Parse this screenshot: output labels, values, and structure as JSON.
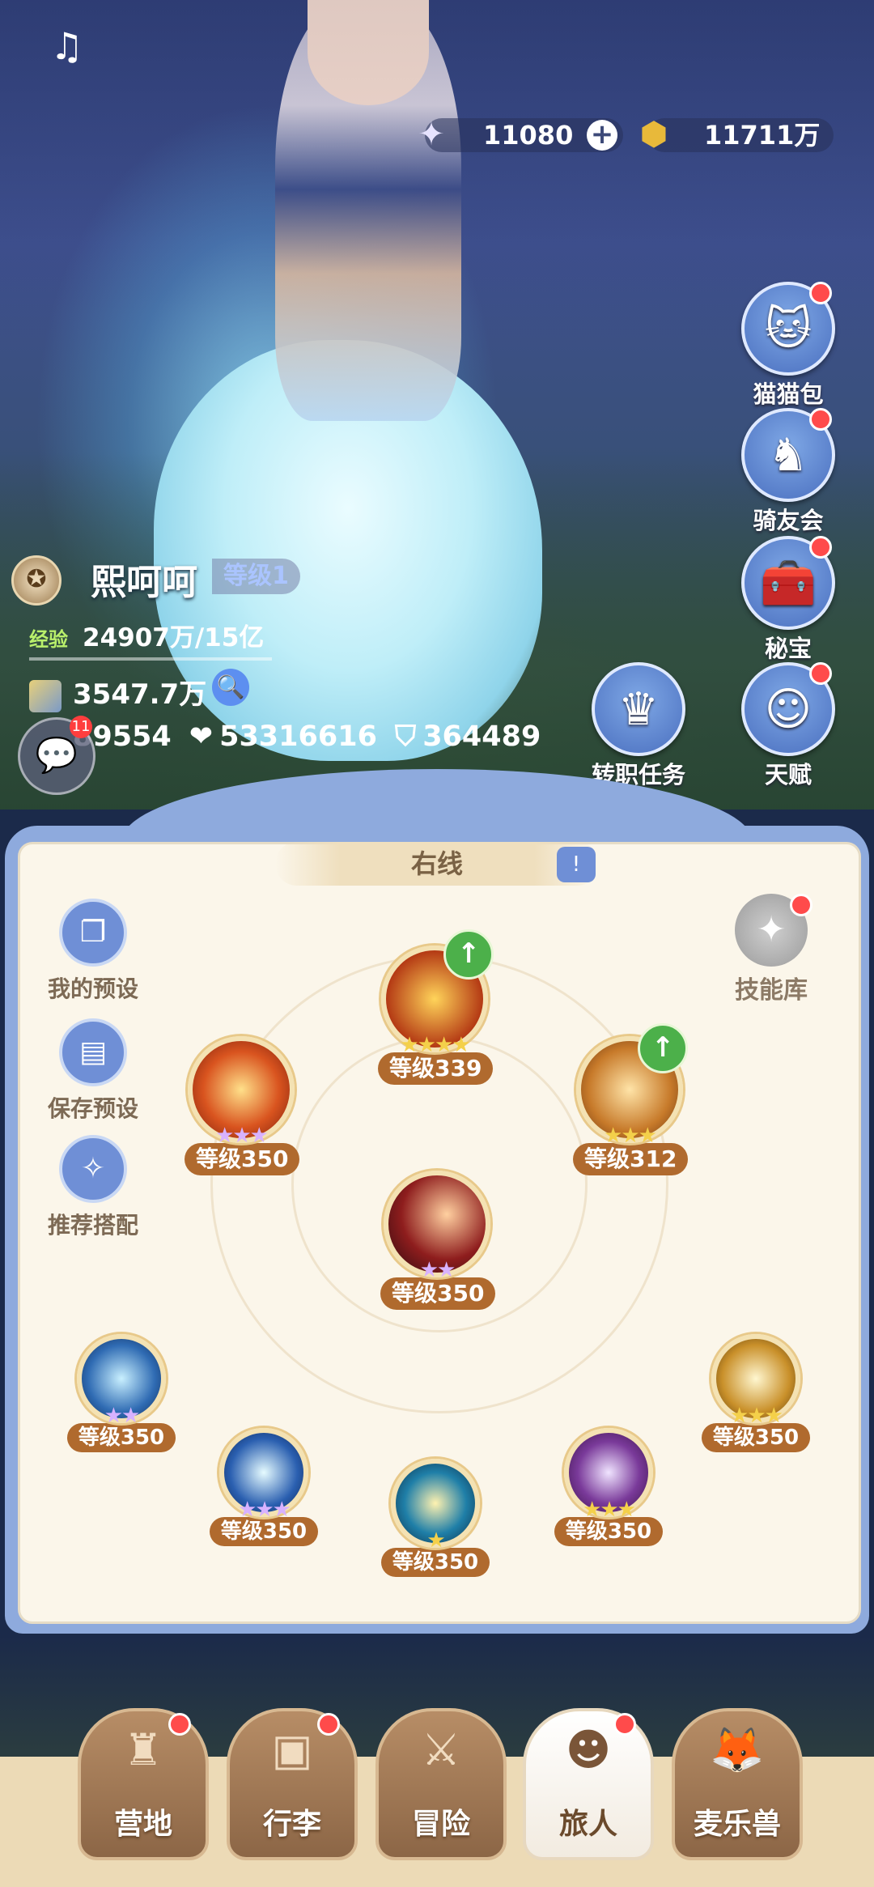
{
  "currency": {
    "stars": "11080",
    "gold": "11711万"
  },
  "side_menu": [
    {
      "label": "猫猫包",
      "icon": "cat-bag-icon"
    },
    {
      "label": "骑友会",
      "icon": "horse-icon"
    },
    {
      "label": "秘宝",
      "icon": "treasure-chest-icon"
    },
    {
      "label": "天赋",
      "icon": "talent-head-icon"
    },
    {
      "label": "转职任务",
      "icon": "crown-badge-icon"
    }
  ],
  "player": {
    "name": "熙呵呵",
    "level_tag": "等级1",
    "exp_label": "经验",
    "exp_value": "24907万/15亿",
    "power": "3547.7万",
    "attack_partial": "89554",
    "hp": "53316616",
    "defense": "364489",
    "chat_badge": "11"
  },
  "skill_panel": {
    "line_title": "右线",
    "actions": [
      "我的预设",
      "保存预设",
      "推荐搭配"
    ],
    "skill_library": "技能库",
    "skills": [
      {
        "id": "top",
        "level": "等级339",
        "stars": "★★★★",
        "star_color": "#f4d04a",
        "orb": "#b43a14",
        "upgrade": true
      },
      {
        "id": "left",
        "level": "等级350",
        "stars": "★★★",
        "star_color": "#d8b2ff",
        "orb": "#d9541f",
        "upgrade": false
      },
      {
        "id": "right",
        "level": "等级312",
        "stars": "★★★",
        "star_color": "#f4d04a",
        "orb": "#c77a2a",
        "upgrade": true
      },
      {
        "id": "center",
        "level": "等级350",
        "stars": "★★",
        "star_color": "#d8b2ff",
        "orb": "#8e1d1d",
        "upgrade": false
      },
      {
        "id": "p1",
        "level": "等级350",
        "stars": "★★",
        "star_color": "#d8b2ff",
        "orb": "#2f6bb3",
        "upgrade": false
      },
      {
        "id": "p2",
        "level": "等级350",
        "stars": "★★★",
        "star_color": "#d8b2ff",
        "orb": "#2a5fb0",
        "upgrade": false
      },
      {
        "id": "p3",
        "level": "等级350",
        "stars": "★",
        "star_color": "#f4d04a",
        "orb": "#1f7fa8",
        "upgrade": false
      },
      {
        "id": "p4",
        "level": "等级350",
        "stars": "★★★",
        "star_color": "#f4d04a",
        "orb": "#7a3a9a",
        "upgrade": false
      },
      {
        "id": "p5",
        "level": "等级350",
        "stars": "★★★",
        "star_color": "#f4d04a",
        "orb": "#c9902a",
        "upgrade": false
      }
    ]
  },
  "bottom_nav": [
    {
      "label": "营地",
      "icon": "castle-icon",
      "active": false
    },
    {
      "label": "行李",
      "icon": "backpack-icon",
      "active": false
    },
    {
      "label": "冒险",
      "icon": "crossed-swords-icon",
      "active": false
    },
    {
      "label": "旅人",
      "icon": "traveler-avatar-icon",
      "active": true
    },
    {
      "label": "麦乐兽",
      "icon": "fox-pet-icon",
      "active": false
    }
  ]
}
